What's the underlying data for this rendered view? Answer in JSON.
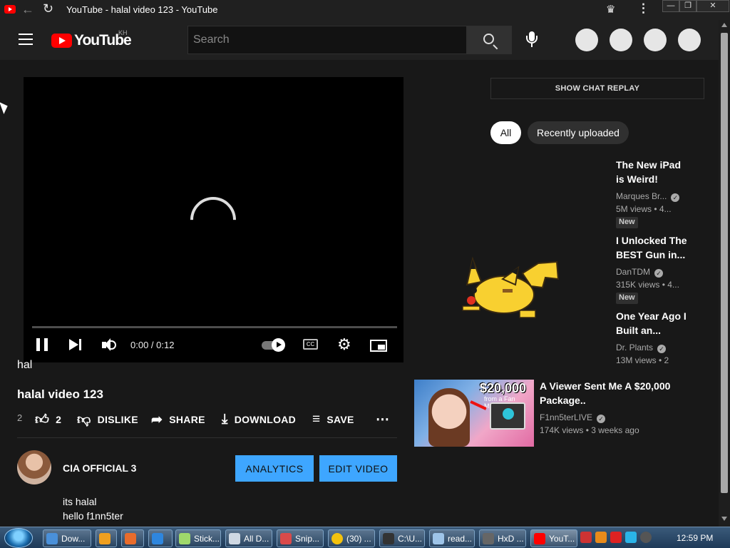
{
  "browser": {
    "tab_title": "YouTube - halal video 123 - YouTube",
    "icons": {
      "back": "back-arrow-icon",
      "reload": "reload-icon",
      "extensions": "puzzle-icon",
      "menu": "kebab-menu-icon"
    },
    "window_buttons": [
      "minimize",
      "restore",
      "close"
    ]
  },
  "header": {
    "logo_text": "YouTube",
    "region": "KH",
    "search_placeholder": "Search"
  },
  "player": {
    "time_display": "0:00 / 0:12",
    "cc_label": "CC",
    "overlay_text": "hal",
    "state": "loading"
  },
  "video": {
    "title": "halal video 123",
    "views": "2",
    "actions": {
      "likes": "2",
      "dislike": "DISLIKE",
      "share": "SHARE",
      "download": "DOWNLOAD",
      "save": "SAVE"
    },
    "channel": "CIA OFFICIAL 3",
    "analytics_label": "ANALYTICS",
    "edit_label": "EDIT VIDEO",
    "description": [
      "its halal",
      "hello f1nn5ter"
    ]
  },
  "sidebar": {
    "chat_replay": "SHOW CHAT REPLAY",
    "chips": [
      "All",
      "Recently uploaded"
    ],
    "recommendations": [
      {
        "title_1": "The New iPad",
        "title_2": "is Weird!",
        "channel": "Marques Br...",
        "meta": "5M views  • 4...",
        "badge": "New"
      },
      {
        "title_1": "I Unlocked The",
        "title_2": "BEST Gun in...",
        "channel": "DanTDM",
        "meta": "315K views  • 4...",
        "badge": "New"
      },
      {
        "title_1": "One Year Ago I",
        "title_2": "Built an...",
        "channel": "Dr. Plants",
        "meta": "13M views  • 2"
      },
      {
        "title_1": "A Viewer Sent Me A $20,000",
        "title_2": "Package..",
        "channel": "F1nn5terLIVE",
        "meta": "174K views  • 3 weeks ago",
        "thumb_price": "$20,000",
        "thumb_sub": "from a Fan Muses"
      }
    ]
  },
  "taskbar": {
    "items": [
      "Dow...",
      "",
      "",
      "",
      "Stick...",
      "All D...",
      "Snip...",
      "(30) ...",
      "C:\\U...",
      "read...",
      "HxD ...",
      "YouT..."
    ],
    "clock": "12:59 PM"
  },
  "colors": {
    "accent_blue": "#3ea6ff",
    "brand_red": "#ff0000",
    "background": "#181818"
  }
}
